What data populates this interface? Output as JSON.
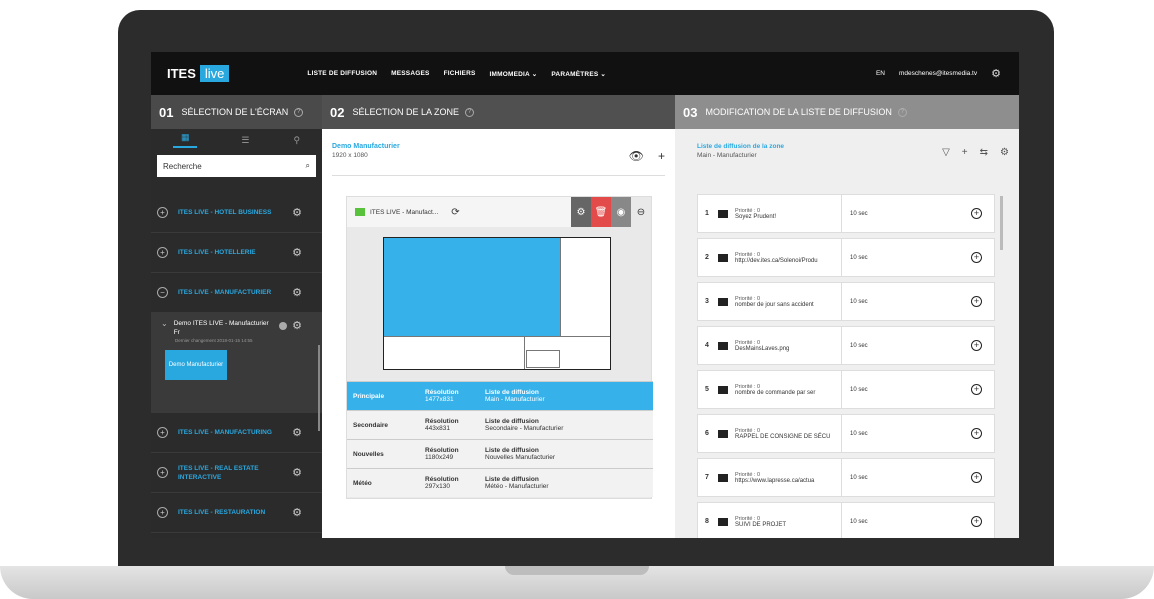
{
  "topbar": {
    "logo_text": "ITES",
    "logo_live": "live",
    "nav": [
      "LISTE DE DIFFUSION",
      "MESSAGES",
      "FICHIERS",
      "IMMOMEDIA",
      "PARAMÈTRES"
    ],
    "lang": "EN",
    "user_email": "mdeschenes@itesmedia.tv"
  },
  "col1": {
    "num": "01",
    "title": "SÉLECTION DE L'ÉCRAN",
    "search_placeholder": "Recherche",
    "screens": [
      {
        "name": "ITES LIVE - HOTEL BUSINESS",
        "toggle": "+"
      },
      {
        "name": "ITES LIVE - HOTELLERIE",
        "toggle": "+"
      },
      {
        "name": "ITES LIVE - MANUFACTURIER",
        "toggle": "−"
      }
    ],
    "sub": {
      "name": "Demo ITES LIVE - Manufacturier Fr",
      "date": "Dernier changement 2018-01-15 14:55",
      "button": "Demo Manufacturier"
    },
    "screens_after": [
      {
        "name": "ITES LIVE - MANUFACTURING",
        "toggle": "+"
      },
      {
        "name": "ITES LIVE - REAL ESTATE INTERACTIVE",
        "toggle": "+"
      },
      {
        "name": "ITES LIVE - RESTAURATION",
        "toggle": "+"
      }
    ]
  },
  "col2": {
    "num": "02",
    "title": "SÉLECTION DE LA ZONE",
    "zone_title": "Demo Manufacturier",
    "zone_resolution": "1920 x 1080",
    "layout_name": "ITES LIVE - Manufact...",
    "zones": [
      {
        "name": "Principale",
        "res_label": "Résolution",
        "res": "1477x831",
        "list_label": "Liste de diffusion",
        "list": "Main - Manufacturier"
      },
      {
        "name": "Secondaire",
        "res_label": "Résolution",
        "res": "443x831",
        "list_label": "Liste de diffusion",
        "list": "Secondaire - Manufacturier"
      },
      {
        "name": "Nouvelles",
        "res_label": "Résolution",
        "res": "1180x249",
        "list_label": "Liste de diffusion",
        "list": "Nouvelles Manufacturier"
      },
      {
        "name": "Météo",
        "res_label": "Résolution",
        "res": "297x130",
        "list_label": "Liste de diffusion",
        "list": "Météo - Manufacturier"
      }
    ]
  },
  "col3": {
    "num": "03",
    "title": "MODIFICATION DE LA LISTE DE DIFFUSION",
    "list_title": "Liste de diffusion de la zone",
    "list_sub": "Main - Manufacturier",
    "items": [
      {
        "n": "1",
        "prio": "Priorité : 0",
        "text": "Soyez Prudent!",
        "dur": "10 sec"
      },
      {
        "n": "2",
        "prio": "Priorité : 0",
        "text": "http://dev.ites.ca/Solenoi/Produ",
        "dur": "10 sec"
      },
      {
        "n": "3",
        "prio": "Priorité : 0",
        "text": "nomber de jour sans accident",
        "dur": "10 sec"
      },
      {
        "n": "4",
        "prio": "Priorité : 0",
        "text": "DesMainsLaves.png",
        "dur": "10 sec"
      },
      {
        "n": "5",
        "prio": "Priorité : 0",
        "text": "nombre de commande par ser",
        "dur": "10 sec"
      },
      {
        "n": "6",
        "prio": "Priorité : 0",
        "text": "RAPPEL DE CONSIGNE DE SÉCU",
        "dur": "10 sec"
      },
      {
        "n": "7",
        "prio": "Priorité : 0",
        "text": "https://www.lapresse.ca/actua",
        "dur": "10 sec"
      },
      {
        "n": "8",
        "prio": "Priorité : 0",
        "text": "SUIVI DE PROJET",
        "dur": "10 sec"
      }
    ]
  }
}
